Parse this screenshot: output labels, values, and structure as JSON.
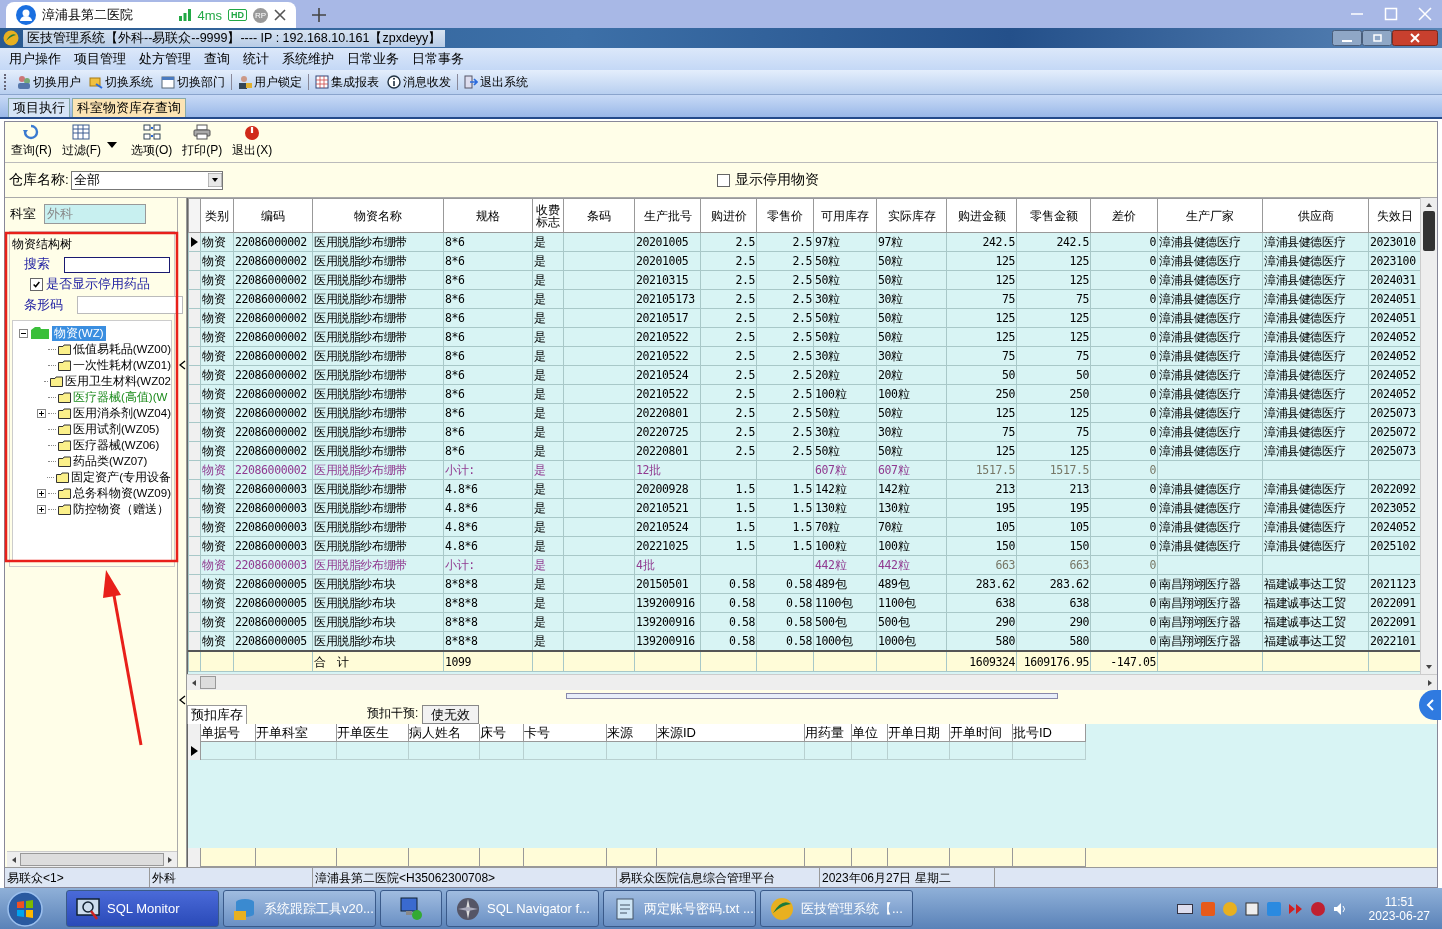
{
  "browser": {
    "tab_title": "漳浦县第二医院",
    "latency": "4ms",
    "badges": [
      "HD",
      "RP"
    ]
  },
  "window": {
    "title": "医技管理系统【外科--易联众--9999】---- IP : 192.168.10.161【zpxdeyy】"
  },
  "menu": [
    "用户操作",
    "项目管理",
    "处方管理",
    "查询",
    "统计",
    "系统维护",
    "日常业务",
    "日常事务"
  ],
  "toolbar": {
    "groups": [
      [
        "切换用户",
        "切换系统",
        "切换部门"
      ],
      [
        "用户锁定"
      ],
      [
        "集成报表",
        "消息收发"
      ],
      [
        "退出系统"
      ]
    ]
  },
  "doc_tabs": [
    {
      "label": "项目执行",
      "selected": false
    },
    {
      "label": "科室物资库存查询",
      "selected": true
    }
  ],
  "actions": [
    "查询(R)",
    "过滤(F)",
    "选项(O)",
    "打印(P)",
    "退出(X)"
  ],
  "warehouse": {
    "label": "仓库名称:",
    "value": "全部"
  },
  "show_disabled": {
    "label": "显示停用物资",
    "checked": false
  },
  "left": {
    "dept_label": "科室",
    "dept_value": "外科",
    "group_title": "物资结构树",
    "search_label": "搜索",
    "show_disabled_drugs": {
      "label": "是否显示停用药品",
      "checked": true
    },
    "barcode_label": "条形码",
    "tree": [
      {
        "label": "物资(WZ)",
        "selected": true,
        "expanded": true,
        "children": [
          {
            "label": "低值易耗品(WZ00)",
            "has_children": false,
            "highlighted": false
          },
          {
            "label": "一次性耗材(WZ01)",
            "has_children": false,
            "highlighted": false
          },
          {
            "label": "医用卫生材料(WZ02",
            "has_children": false,
            "highlighted": false
          },
          {
            "label": "医疗器械(高值)(W",
            "has_children": false,
            "highlighted": true
          },
          {
            "label": "医用消杀剂(WZ04)",
            "has_children": true,
            "highlighted": false
          },
          {
            "label": "医用试剂(WZ05)",
            "has_children": false,
            "highlighted": false
          },
          {
            "label": "医疗器械(WZ06)",
            "has_children": false,
            "highlighted": false
          },
          {
            "label": "药品类(WZ07)",
            "has_children": false,
            "highlighted": false
          },
          {
            "label": "固定资产(专用设备",
            "has_children": false,
            "highlighted": false
          },
          {
            "label": "总务科物资(WZ09)",
            "has_children": true,
            "highlighted": false
          },
          {
            "label": "防控物资（赠送）",
            "has_children": true,
            "highlighted": false
          }
        ]
      }
    ]
  },
  "table": {
    "columns": [
      "类别",
      "编码",
      "物资名称",
      "规格",
      "收费标志",
      "条码",
      "生产批号",
      "购进价",
      "零售价",
      "可用库存",
      "实际库存",
      "购进金额",
      "零售金额",
      "差价",
      "生产厂家",
      "供应商",
      "失效日"
    ],
    "rows": [
      {
        "kind": "item",
        "selected": true,
        "cells": [
          "物资",
          "22086000002",
          "医用脱脂纱布绷带",
          "8*6",
          "是",
          null,
          "20201005",
          "2.5",
          "2.5",
          "97粒",
          "97粒",
          "242.5",
          "242.5",
          "0",
          "漳浦县健德医疗",
          "漳浦县健德医疗",
          "2023010"
        ]
      },
      {
        "kind": "item",
        "selected": false,
        "cells": [
          "物资",
          "22086000002",
          "医用脱脂纱布绷带",
          "8*6",
          "是",
          null,
          "20201005",
          "2.5",
          "2.5",
          "50粒",
          "50粒",
          "125",
          "125",
          "0",
          "漳浦县健德医疗",
          "漳浦县健德医疗",
          "2023100"
        ]
      },
      {
        "kind": "item",
        "selected": false,
        "cells": [
          "物资",
          "22086000002",
          "医用脱脂纱布绷带",
          "8*6",
          "是",
          null,
          "20210315",
          "2.5",
          "2.5",
          "50粒",
          "50粒",
          "125",
          "125",
          "0",
          "漳浦县健德医疗",
          "漳浦县健德医疗",
          "2024031"
        ]
      },
      {
        "kind": "item",
        "selected": false,
        "cells": [
          "物资",
          "22086000002",
          "医用脱脂纱布绷带",
          "8*6",
          "是",
          null,
          "202105173",
          "2.5",
          "2.5",
          "30粒",
          "30粒",
          "75",
          "75",
          "0",
          "漳浦县健德医疗",
          "漳浦县健德医疗",
          "2024051"
        ]
      },
      {
        "kind": "item",
        "selected": false,
        "cells": [
          "物资",
          "22086000002",
          "医用脱脂纱布绷带",
          "8*6",
          "是",
          null,
          "20210517",
          "2.5",
          "2.5",
          "50粒",
          "50粒",
          "125",
          "125",
          "0",
          "漳浦县健德医疗",
          "漳浦县健德医疗",
          "2024051"
        ]
      },
      {
        "kind": "item",
        "selected": false,
        "cells": [
          "物资",
          "22086000002",
          "医用脱脂纱布绷带",
          "8*6",
          "是",
          null,
          "20210522",
          "2.5",
          "2.5",
          "50粒",
          "50粒",
          "125",
          "125",
          "0",
          "漳浦县健德医疗",
          "漳浦县健德医疗",
          "2024052"
        ]
      },
      {
        "kind": "item",
        "selected": false,
        "cells": [
          "物资",
          "22086000002",
          "医用脱脂纱布绷带",
          "8*6",
          "是",
          null,
          "20210522",
          "2.5",
          "2.5",
          "30粒",
          "30粒",
          "75",
          "75",
          "0",
          "漳浦县健德医疗",
          "漳浦县健德医疗",
          "2024052"
        ]
      },
      {
        "kind": "item",
        "selected": false,
        "cells": [
          "物资",
          "22086000002",
          "医用脱脂纱布绷带",
          "8*6",
          "是",
          null,
          "20210524",
          "2.5",
          "2.5",
          "20粒",
          "20粒",
          "50",
          "50",
          "0",
          "漳浦县健德医疗",
          "漳浦县健德医疗",
          "2024052"
        ]
      },
      {
        "kind": "item",
        "selected": false,
        "cells": [
          "物资",
          "22086000002",
          "医用脱脂纱布绷带",
          "8*6",
          "是",
          null,
          "20210522",
          "2.5",
          "2.5",
          "100粒",
          "100粒",
          "250",
          "250",
          "0",
          "漳浦县健德医疗",
          "漳浦县健德医疗",
          "2024052"
        ]
      },
      {
        "kind": "item",
        "selected": false,
        "cells": [
          "物资",
          "22086000002",
          "医用脱脂纱布绷带",
          "8*6",
          "是",
          null,
          "20220801",
          "2.5",
          "2.5",
          "50粒",
          "50粒",
          "125",
          "125",
          "0",
          "漳浦县健德医疗",
          "漳浦县健德医疗",
          "2025073"
        ]
      },
      {
        "kind": "item",
        "selected": false,
        "cells": [
          "物资",
          "22086000002",
          "医用脱脂纱布绷带",
          "8*6",
          "是",
          null,
          "20220725",
          "2.5",
          "2.5",
          "30粒",
          "30粒",
          "75",
          "75",
          "0",
          "漳浦县健德医疗",
          "漳浦县健德医疗",
          "2025072"
        ]
      },
      {
        "kind": "item",
        "selected": false,
        "cells": [
          "物资",
          "22086000002",
          "医用脱脂纱布绷带",
          "8*6",
          "是",
          null,
          "20220801",
          "2.5",
          "2.5",
          "50粒",
          "50粒",
          "125",
          "125",
          "0",
          "漳浦县健德医疗",
          "漳浦县健德医疗",
          "2025073"
        ]
      },
      {
        "kind": "subtotal",
        "selected": false,
        "cells": [
          "物资",
          "22086000002",
          "医用脱脂纱布绷带",
          "小计:",
          "是",
          null,
          "12批",
          null,
          null,
          "607粒",
          "607粒",
          "1517.5",
          "1517.5",
          "0",
          null,
          null,
          null
        ]
      },
      {
        "kind": "item",
        "selected": false,
        "cells": [
          "物资",
          "22086000003",
          "医用脱脂纱布绷带",
          "4.8*6",
          "是",
          null,
          "20200928",
          "1.5",
          "1.5",
          "142粒",
          "142粒",
          "213",
          "213",
          "0",
          "漳浦县健德医疗",
          "漳浦县健德医疗",
          "2022092"
        ]
      },
      {
        "kind": "item",
        "selected": false,
        "cells": [
          "物资",
          "22086000003",
          "医用脱脂纱布绷带",
          "4.8*6",
          "是",
          null,
          "20210521",
          "1.5",
          "1.5",
          "130粒",
          "130粒",
          "195",
          "195",
          "0",
          "漳浦县健德医疗",
          "漳浦县健德医疗",
          "2023052"
        ]
      },
      {
        "kind": "item",
        "selected": false,
        "cells": [
          "物资",
          "22086000003",
          "医用脱脂纱布绷带",
          "4.8*6",
          "是",
          null,
          "20210524",
          "1.5",
          "1.5",
          "70粒",
          "70粒",
          "105",
          "105",
          "0",
          "漳浦县健德医疗",
          "漳浦县健德医疗",
          "2024052"
        ]
      },
      {
        "kind": "item",
        "selected": false,
        "cells": [
          "物资",
          "22086000003",
          "医用脱脂纱布绷带",
          "4.8*6",
          "是",
          null,
          "20221025",
          "1.5",
          "1.5",
          "100粒",
          "100粒",
          "150",
          "150",
          "0",
          "漳浦县健德医疗",
          "漳浦县健德医疗",
          "2025102"
        ]
      },
      {
        "kind": "subtotal",
        "selected": false,
        "cells": [
          "物资",
          "22086000003",
          "医用脱脂纱布绷带",
          "小计:",
          "是",
          null,
          "4批",
          null,
          null,
          "442粒",
          "442粒",
          "663",
          "663",
          "0",
          null,
          null,
          null
        ]
      },
      {
        "kind": "item",
        "selected": false,
        "cells": [
          "物资",
          "22086000005",
          "医用脱脂纱布块",
          "8*8*8",
          "是",
          null,
          "20150501",
          "0.58",
          "0.58",
          "489包",
          "489包",
          "283.62",
          "283.62",
          "0",
          "南昌翔翊医疗器",
          "福建诚事达工贸",
          "2021123"
        ]
      },
      {
        "kind": "item",
        "selected": false,
        "cells": [
          "物资",
          "22086000005",
          "医用脱脂纱布块",
          "8*8*8",
          "是",
          null,
          "139200916",
          "0.58",
          "0.58",
          "1100包",
          "1100包",
          "638",
          "638",
          "0",
          "南昌翔翊医疗器",
          "福建诚事达工贸",
          "2022091"
        ]
      },
      {
        "kind": "item",
        "selected": false,
        "cells": [
          "物资",
          "22086000005",
          "医用脱脂纱布块",
          "8*8*8",
          "是",
          null,
          "139200916",
          "0.58",
          "0.58",
          "500包",
          "500包",
          "290",
          "290",
          "0",
          "南昌翔翊医疗器",
          "福建诚事达工贸",
          "2022091"
        ]
      },
      {
        "kind": "item",
        "selected": false,
        "cells": [
          "物资",
          "22086000005",
          "医用脱脂纱布块",
          "8*8*8",
          "是",
          null,
          "139200916",
          "0.58",
          "0.58",
          "1000包",
          "1000包",
          "580",
          "580",
          "0",
          "南昌翔翊医疗器",
          "福建诚事达工贸",
          "2022101"
        ]
      }
    ],
    "total": {
      "label": "合　计",
      "count": "1099",
      "buy_amount": "1609324",
      "retail_amount": "1609176.95",
      "price_difference": "-147.05"
    }
  },
  "reserved": {
    "tab": "预扣库存",
    "intervene_label": "预扣干预:",
    "invalidate_button": "使无效",
    "columns": [
      "单据号",
      "开单科室",
      "开单医生",
      "病人姓名",
      "床号",
      "卡号",
      "来源",
      "来源ID",
      "用药量",
      "单位",
      "开单日期",
      "开单时间",
      "批号ID"
    ]
  },
  "status_bar": [
    "易联众<1>",
    "外科",
    "漳浦县第二医院<H35062300708>",
    "易联众医院信息综合管理平台",
    "2023年06月27日 星期二"
  ],
  "taskbar": {
    "items": [
      {
        "label": "SQL Monitor",
        "selected": true
      },
      {
        "label": "系统跟踪工具v20...",
        "selected": false
      },
      {
        "selected": false
      },
      {
        "label": "SQL Navigator f...",
        "selected": false
      },
      {
        "label": "两定账号密码.txt ...",
        "selected": false
      },
      {
        "label": "医技管理系统【...",
        "selected": false
      }
    ],
    "time": "11:51",
    "date": "2023-06-27"
  }
}
